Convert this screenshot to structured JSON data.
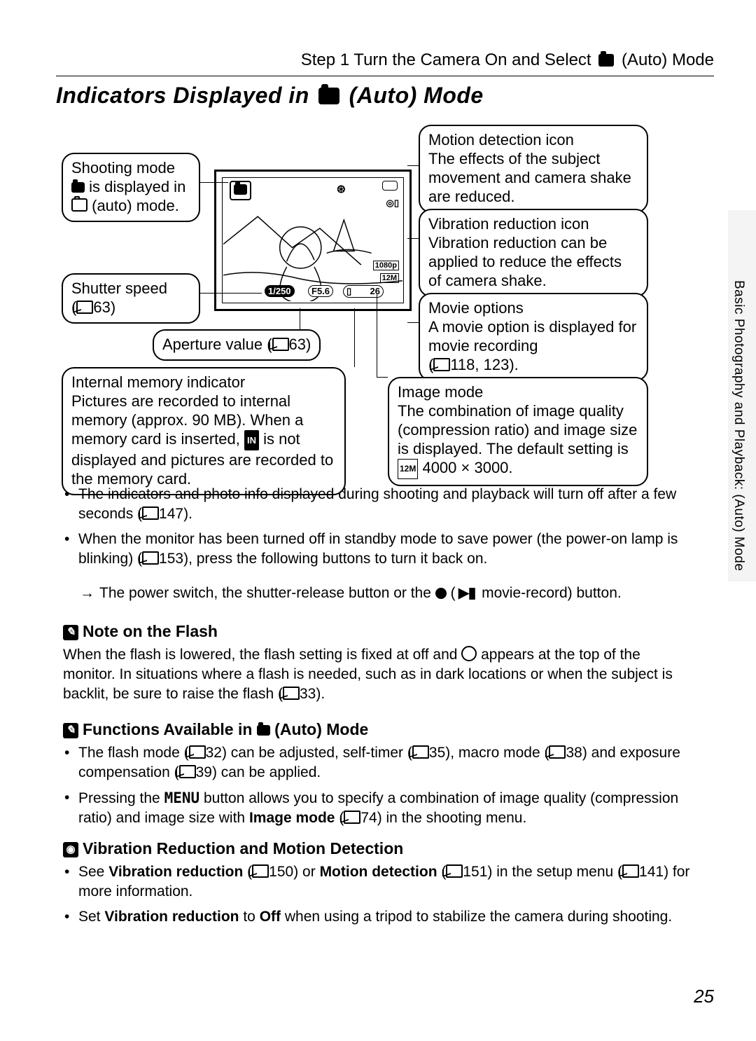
{
  "header": {
    "step": "Step 1 Turn the Camera On and Select",
    "mode": " (Auto) Mode"
  },
  "thumb": "Basic Photography and Playback:      (Auto) Mode",
  "title": {
    "a": "Indicators Displayed in ",
    "b": " (Auto) Mode"
  },
  "callout": {
    "shooting": {
      "t": "Shooting mode",
      "l2": " is displayed in",
      "l3": " (auto) mode."
    },
    "shutter": {
      "t": "Shutter speed",
      "pg": "63"
    },
    "aperture": {
      "t": "Aperture value (",
      "pg": "63",
      "end": ")"
    },
    "internal": {
      "t": "Internal memory indicator",
      "b": "Pictures are recorded to internal memory (approx. 90 MB). When a memory card is inserted, ",
      "b2": " is not displayed and pictures are recorded to the memory card."
    },
    "motion": {
      "t": "Motion detection icon",
      "b": "The effects of the subject movement and camera shake are reduced."
    },
    "vr": {
      "t": "Vibration reduction icon",
      "b": "Vibration reduction can be applied to reduce the effects of camera shake."
    },
    "movie": {
      "t": "Movie options",
      "b": "A movie option is displayed for movie recording",
      "pg": "118, 123",
      "end": ")."
    },
    "image": {
      "t": "Image mode",
      "b": "The combination of image quality (compression ratio) and image size is displayed. The default setting is ",
      "val": " 4000 × 3000."
    }
  },
  "vf": {
    "shutter": "1/250",
    "fnum": "F5.6",
    "count": "26",
    "res": "12M",
    "hd": "1080p"
  },
  "bul1": {
    "a": "The indicators and photo info displayed during shooting and playback will turn off after a few seconds (",
    "pg": "147",
    "b": ")."
  },
  "bul2": {
    "a": "When the monitor has been turned off in standby mode to save power (the power-on lamp is blinking) (",
    "pg": "153",
    "b": "), press the following buttons to turn it back on."
  },
  "sub1": {
    "a": "The power switch, the shutter-release button or the ",
    "b": " (",
    "c": " movie-record) button."
  },
  "sec1": "Note on the Flash",
  "p1": {
    "a": "When the flash is lowered, the flash setting is fixed at off and ",
    "b": " appears at the top of the monitor. In situations where a flash is needed, such as in dark locations or when the subject is backlit, be sure to raise the flash (",
    "pg": "33",
    "c": ")."
  },
  "sec2": {
    "a": "Functions Available in ",
    "b": " (Auto) Mode"
  },
  "f1": {
    "a": "The flash mode (",
    "p1": "32",
    "b": ") can be adjusted, self-timer (",
    "p2": "35",
    "c": "), macro mode (",
    "p3": "38",
    "d": ") and exposure compensation (",
    "p4": "39",
    "e": ") can be applied."
  },
  "f2": {
    "a": "Pressing the ",
    "menu": "MENU",
    "b": " button allows you to specify a combination of image quality (compression ratio) and image size with ",
    "bold": "Image mode",
    "c": " (",
    "pg": "74",
    "d": ") in the shooting menu."
  },
  "sec3": "Vibration Reduction and Motion Detection",
  "v1": {
    "a": "See ",
    "b1": "Vibration reduction",
    "b": " (",
    "p1": "150",
    "c": ") or ",
    "b2": "Motion detection",
    "d": " (",
    "p2": "151",
    "e": ") in the setup menu (",
    "p3": "141",
    "f": ") for more information."
  },
  "v2": {
    "a": "Set ",
    "b1": "Vibration reduction",
    "b": " to ",
    "b2": "Off",
    "c": " when using a tripod to stabilize the camera during shooting."
  },
  "page": "25"
}
